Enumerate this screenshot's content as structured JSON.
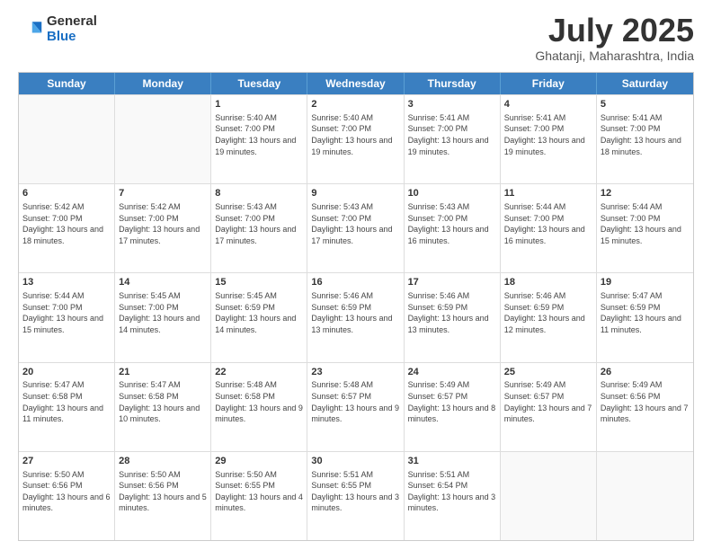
{
  "header": {
    "logo_line1": "General",
    "logo_line2": "Blue",
    "month": "July 2025",
    "location": "Ghatanji, Maharashtra, India"
  },
  "days_of_week": [
    "Sunday",
    "Monday",
    "Tuesday",
    "Wednesday",
    "Thursday",
    "Friday",
    "Saturday"
  ],
  "weeks": [
    [
      {
        "day": "",
        "info": ""
      },
      {
        "day": "",
        "info": ""
      },
      {
        "day": "1",
        "info": "Sunrise: 5:40 AM\nSunset: 7:00 PM\nDaylight: 13 hours and 19 minutes."
      },
      {
        "day": "2",
        "info": "Sunrise: 5:40 AM\nSunset: 7:00 PM\nDaylight: 13 hours and 19 minutes."
      },
      {
        "day": "3",
        "info": "Sunrise: 5:41 AM\nSunset: 7:00 PM\nDaylight: 13 hours and 19 minutes."
      },
      {
        "day": "4",
        "info": "Sunrise: 5:41 AM\nSunset: 7:00 PM\nDaylight: 13 hours and 19 minutes."
      },
      {
        "day": "5",
        "info": "Sunrise: 5:41 AM\nSunset: 7:00 PM\nDaylight: 13 hours and 18 minutes."
      }
    ],
    [
      {
        "day": "6",
        "info": "Sunrise: 5:42 AM\nSunset: 7:00 PM\nDaylight: 13 hours and 18 minutes."
      },
      {
        "day": "7",
        "info": "Sunrise: 5:42 AM\nSunset: 7:00 PM\nDaylight: 13 hours and 17 minutes."
      },
      {
        "day": "8",
        "info": "Sunrise: 5:43 AM\nSunset: 7:00 PM\nDaylight: 13 hours and 17 minutes."
      },
      {
        "day": "9",
        "info": "Sunrise: 5:43 AM\nSunset: 7:00 PM\nDaylight: 13 hours and 17 minutes."
      },
      {
        "day": "10",
        "info": "Sunrise: 5:43 AM\nSunset: 7:00 PM\nDaylight: 13 hours and 16 minutes."
      },
      {
        "day": "11",
        "info": "Sunrise: 5:44 AM\nSunset: 7:00 PM\nDaylight: 13 hours and 16 minutes."
      },
      {
        "day": "12",
        "info": "Sunrise: 5:44 AM\nSunset: 7:00 PM\nDaylight: 13 hours and 15 minutes."
      }
    ],
    [
      {
        "day": "13",
        "info": "Sunrise: 5:44 AM\nSunset: 7:00 PM\nDaylight: 13 hours and 15 minutes."
      },
      {
        "day": "14",
        "info": "Sunrise: 5:45 AM\nSunset: 7:00 PM\nDaylight: 13 hours and 14 minutes."
      },
      {
        "day": "15",
        "info": "Sunrise: 5:45 AM\nSunset: 6:59 PM\nDaylight: 13 hours and 14 minutes."
      },
      {
        "day": "16",
        "info": "Sunrise: 5:46 AM\nSunset: 6:59 PM\nDaylight: 13 hours and 13 minutes."
      },
      {
        "day": "17",
        "info": "Sunrise: 5:46 AM\nSunset: 6:59 PM\nDaylight: 13 hours and 13 minutes."
      },
      {
        "day": "18",
        "info": "Sunrise: 5:46 AM\nSunset: 6:59 PM\nDaylight: 13 hours and 12 minutes."
      },
      {
        "day": "19",
        "info": "Sunrise: 5:47 AM\nSunset: 6:59 PM\nDaylight: 13 hours and 11 minutes."
      }
    ],
    [
      {
        "day": "20",
        "info": "Sunrise: 5:47 AM\nSunset: 6:58 PM\nDaylight: 13 hours and 11 minutes."
      },
      {
        "day": "21",
        "info": "Sunrise: 5:47 AM\nSunset: 6:58 PM\nDaylight: 13 hours and 10 minutes."
      },
      {
        "day": "22",
        "info": "Sunrise: 5:48 AM\nSunset: 6:58 PM\nDaylight: 13 hours and 9 minutes."
      },
      {
        "day": "23",
        "info": "Sunrise: 5:48 AM\nSunset: 6:57 PM\nDaylight: 13 hours and 9 minutes."
      },
      {
        "day": "24",
        "info": "Sunrise: 5:49 AM\nSunset: 6:57 PM\nDaylight: 13 hours and 8 minutes."
      },
      {
        "day": "25",
        "info": "Sunrise: 5:49 AM\nSunset: 6:57 PM\nDaylight: 13 hours and 7 minutes."
      },
      {
        "day": "26",
        "info": "Sunrise: 5:49 AM\nSunset: 6:56 PM\nDaylight: 13 hours and 7 minutes."
      }
    ],
    [
      {
        "day": "27",
        "info": "Sunrise: 5:50 AM\nSunset: 6:56 PM\nDaylight: 13 hours and 6 minutes."
      },
      {
        "day": "28",
        "info": "Sunrise: 5:50 AM\nSunset: 6:56 PM\nDaylight: 13 hours and 5 minutes."
      },
      {
        "day": "29",
        "info": "Sunrise: 5:50 AM\nSunset: 6:55 PM\nDaylight: 13 hours and 4 minutes."
      },
      {
        "day": "30",
        "info": "Sunrise: 5:51 AM\nSunset: 6:55 PM\nDaylight: 13 hours and 3 minutes."
      },
      {
        "day": "31",
        "info": "Sunrise: 5:51 AM\nSunset: 6:54 PM\nDaylight: 13 hours and 3 minutes."
      },
      {
        "day": "",
        "info": ""
      },
      {
        "day": "",
        "info": ""
      }
    ]
  ]
}
